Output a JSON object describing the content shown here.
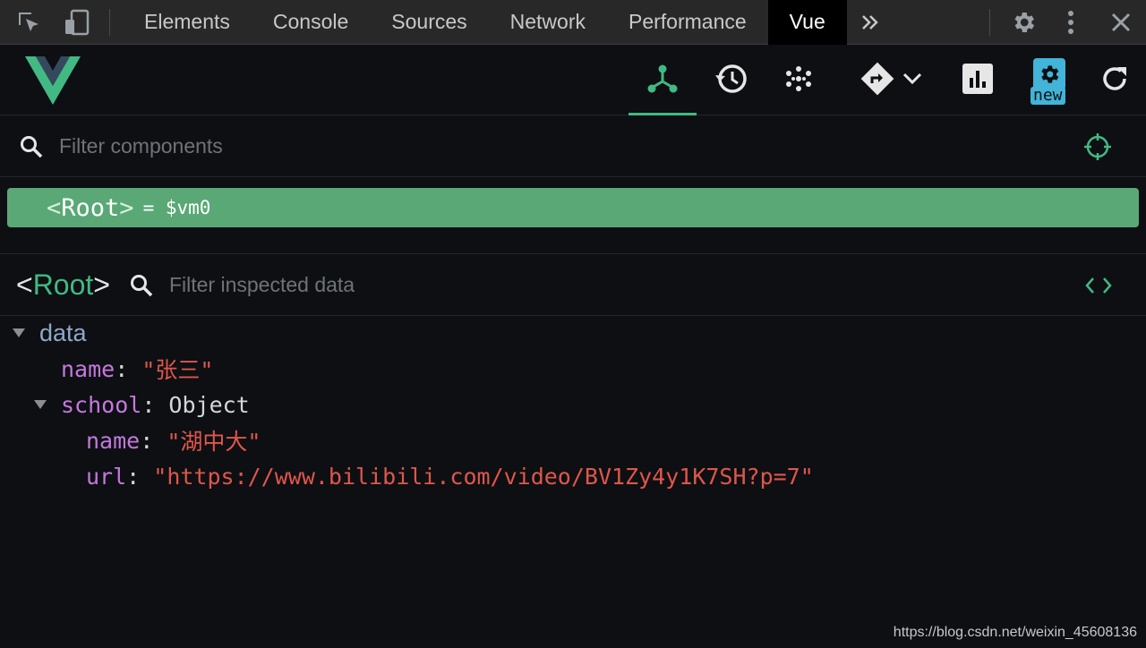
{
  "devtools": {
    "tabs": [
      "Elements",
      "Console",
      "Sources",
      "Network",
      "Performance",
      "Vue"
    ],
    "active_tab": "Vue",
    "icons": [
      "inspect-element-icon",
      "device-toolbar-icon",
      "more-tabs-icon",
      "settings-gear-icon",
      "kebab-menu-icon",
      "close-icon"
    ]
  },
  "vue_toolbar": {
    "icons": [
      "components-icon",
      "vuex-history-icon",
      "events-icon",
      "routing-icon",
      "performance-icon",
      "settings-icon",
      "refresh-icon"
    ],
    "active": "components-icon",
    "settings_badge": "new"
  },
  "filter_components": {
    "placeholder": "Filter components"
  },
  "tree": {
    "selected": {
      "open": "<",
      "name": "Root",
      "close": ">",
      "suffix": "= $vm0"
    }
  },
  "inspector": {
    "title_open": "<",
    "title_name": "Root",
    "title_close": ">",
    "filter_placeholder": "Filter inspected data"
  },
  "data_tree": {
    "section": "data",
    "name_key": "name",
    "name_value": "\"张三\"",
    "school_key": "school",
    "school_type": "Object",
    "school_name_key": "name",
    "school_name_value": "\"湖中大\"",
    "school_url_key": "url",
    "school_url_value": "\"https://www.bilibili.com/video/BV1Zy4y1K7SH?p=7\""
  },
  "watermark": "https://blog.csdn.net/weixin_45608136",
  "colors": {
    "accent": "#42b983",
    "selected_row": "#5aa876",
    "key": "#c678dd",
    "string": "#e0564a"
  }
}
